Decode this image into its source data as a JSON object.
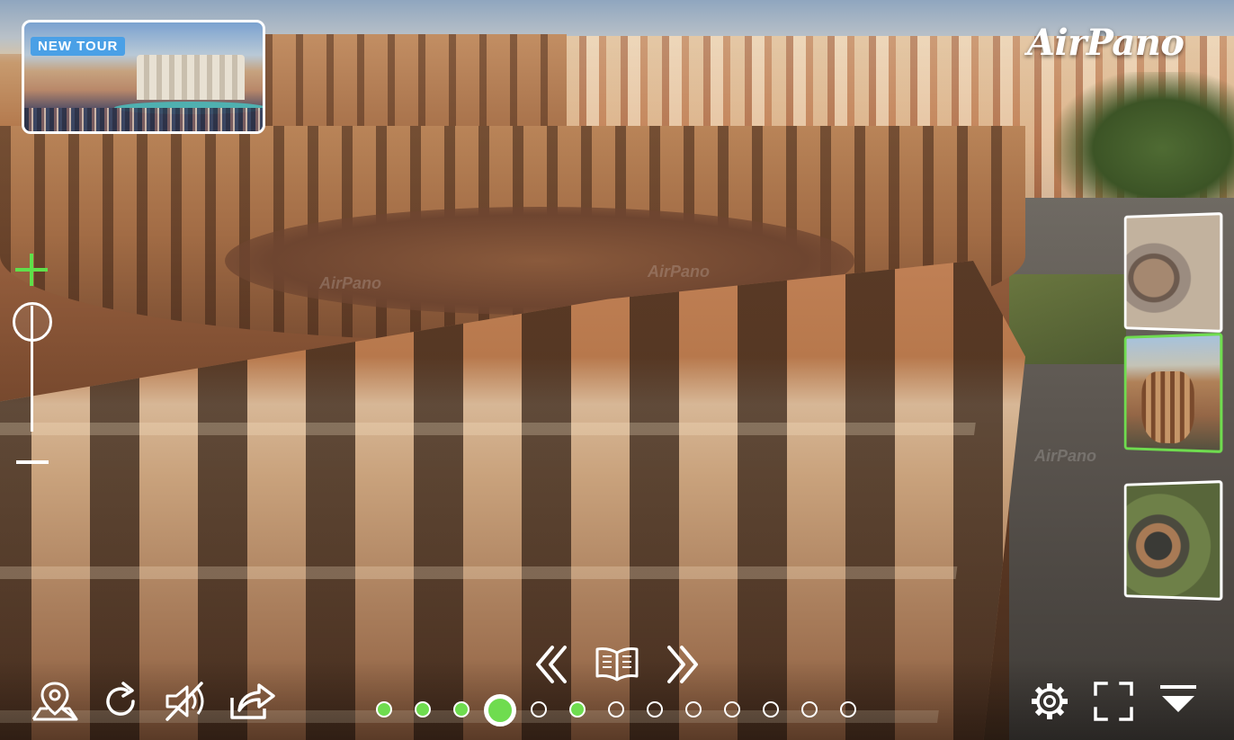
{
  "viewer": {
    "logo_text": "AirPano",
    "watermark_text": "AirPano"
  },
  "new_tour": {
    "badge_label": "NEW TOUR"
  },
  "zoom": {
    "level": 0.12,
    "plus_icon": "plus-icon",
    "minus_icon": "minus-icon"
  },
  "thumbnails": [
    {
      "id": "aerial-top-view",
      "active": false
    },
    {
      "id": "colosseum-sunset",
      "active": true
    },
    {
      "id": "aerial-wide-view",
      "active": false
    }
  ],
  "toolbar": {
    "left": [
      "location-pin-icon",
      "rotate-icon",
      "sound-muted-icon",
      "share-icon"
    ],
    "center": [
      "previous-icon",
      "book-icon",
      "next-icon"
    ],
    "right": [
      "settings-gear-icon",
      "fullscreen-icon",
      "collapse-menu-icon"
    ]
  },
  "pagination": {
    "count": 13,
    "current_index": 3,
    "visited": [
      0,
      1,
      2,
      5
    ]
  },
  "colors": {
    "accent": "#6fdc4f",
    "badge": "#4aa0e6",
    "ui_icon": "#ffffff"
  }
}
